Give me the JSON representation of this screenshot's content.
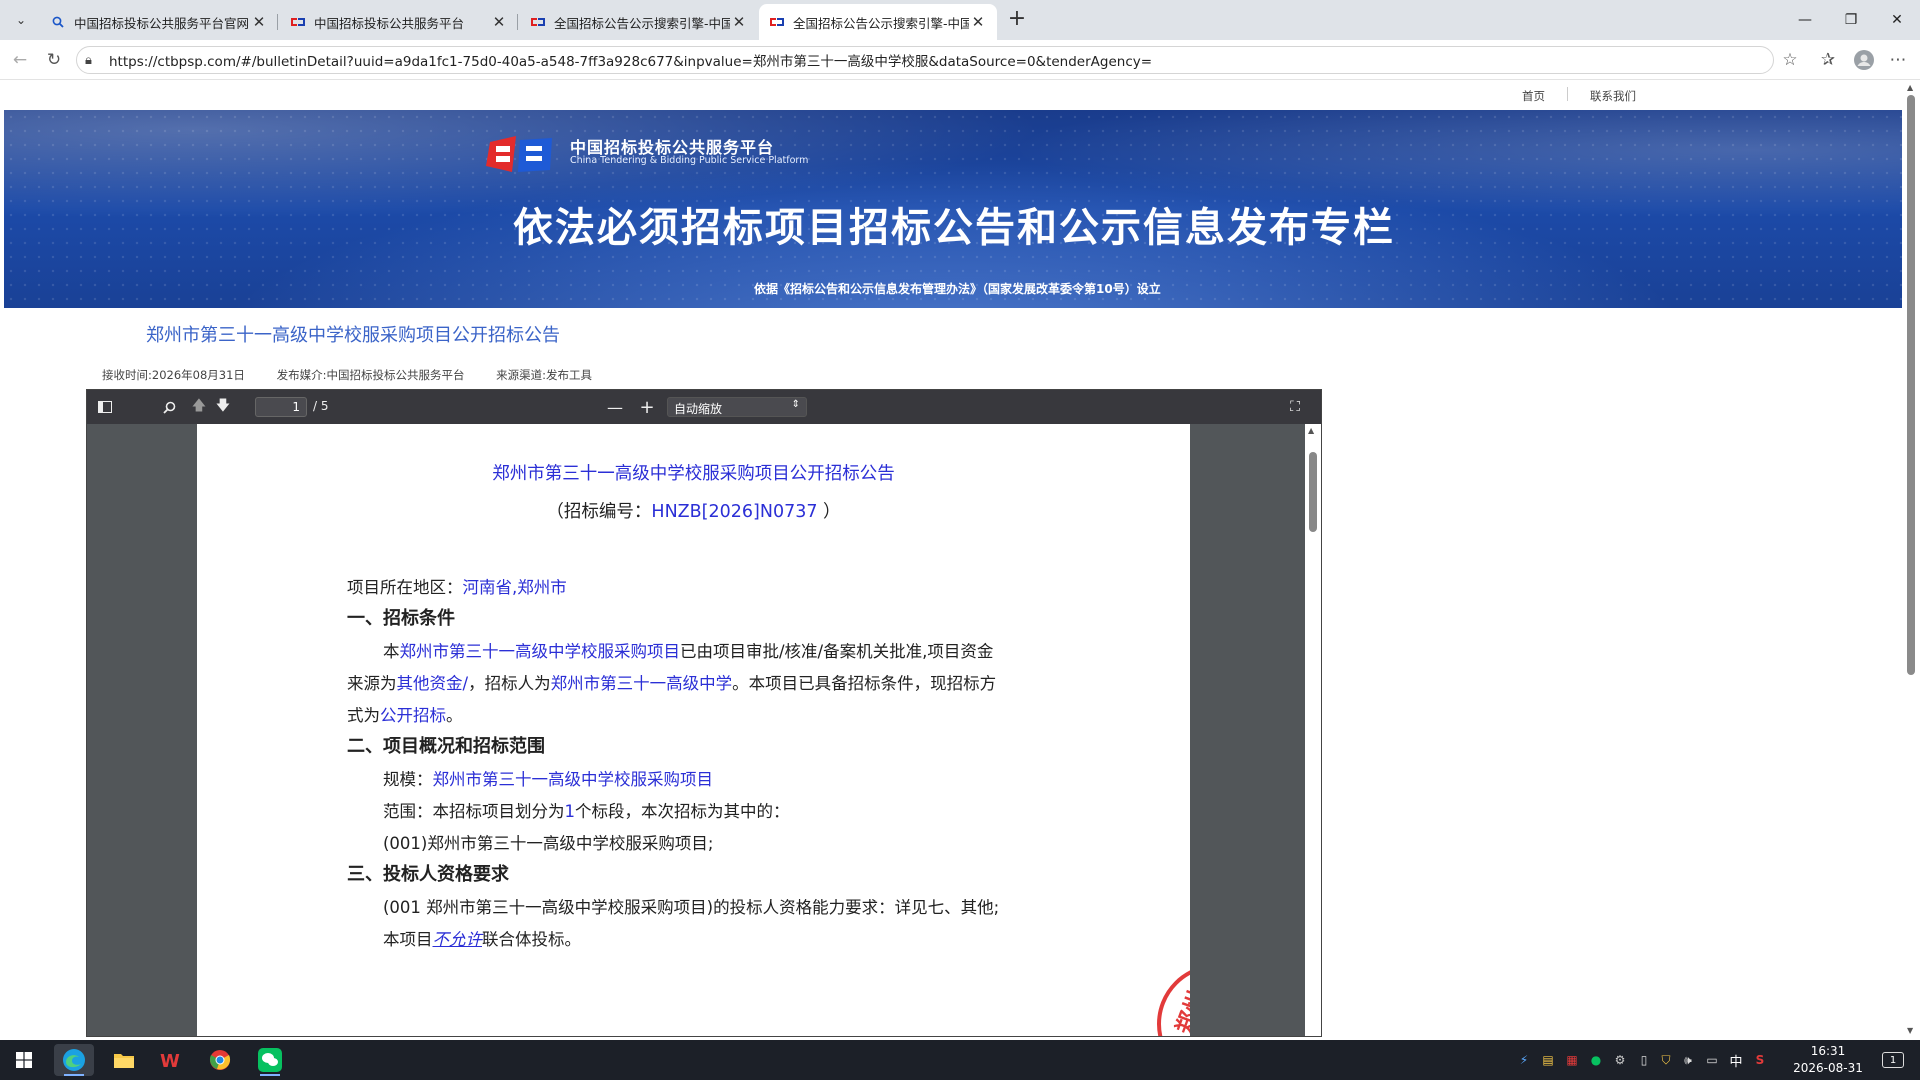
{
  "browser": {
    "tabs": [
      {
        "title": "中国招标投标公共服务平台官网 - 前",
        "icon": "search-icon",
        "active": false
      },
      {
        "title": "中国招标投标公共服务平台",
        "icon": "site-logo-icon",
        "active": false
      },
      {
        "title": "全国招标公告公示搜索引擎-中国招",
        "icon": "site-logo-icon",
        "active": false
      },
      {
        "title": "全国招标公告公示搜索引擎-中国招",
        "icon": "site-logo-icon",
        "active": true
      }
    ],
    "url": "https://ctbpsp.com/#/bulletinDetail?uuid=a9da1fc1-75d0-40a5-a548-7ff3a928c677&inpvalue=郑州市第三十一高级中学校服&dataSource=0&tenderAgency="
  },
  "site": {
    "topnav": {
      "home": "首页",
      "contact": "联系我们"
    },
    "logo_cn": "中国招标投标公共服务平台",
    "logo_en": "China Tendering & Bidding Public Service Platform",
    "banner_title": "依法必须招标项目招标公告和公示信息发布专栏",
    "banner_basis": "依据《招标公告和公示信息发布管理办法》（国家发展改革委令第10号）设立"
  },
  "bulletin": {
    "title": "郑州市第三十一高级中学校服采购项目公开招标公告",
    "received": "接收时间:2026年08月31日",
    "media": "发布媒介:中国招标投标公共服务平台",
    "source": "来源渠道:发布工具"
  },
  "pdf": {
    "page": "1",
    "total": "/ 5",
    "zoom": "自动缩放",
    "title": "郑州市第三十一高级中学校服采购项目公开招标公告",
    "code_prefix": "（招标编号：",
    "code": "HNZB[2026]N0737",
    "code_suffix": " ）",
    "region_label": "项目所在地区：",
    "region": "河南省,郑州市",
    "sec1": "一、招标条件",
    "p1_a": "本",
    "p1_b": "郑州市第三十一高级中学校服采购项目",
    "p1_c": "已由项目审批/核准/备案机关批准,项目资金",
    "p2_a": "来源为",
    "p2_b": "其他资金/",
    "p2_c": "，招标人为",
    "p2_d": "郑州市第三十一高级中学",
    "p2_e": "。本项目已具备招标条件，现招标方",
    "p3_a": "式为",
    "p3_b": "公开招标",
    "p3_c": "。",
    "sec2": "二、项目概况和招标范围",
    "scale_label": "规模：",
    "scale": "郑州市第三十一高级中学校服采购项目",
    "scope_a": "范围：本招标项目划分为",
    "scope_b": "1",
    "scope_c": "个标段，本次招标为其中的：",
    "lot": "(001)郑州市第三十一高级中学校服采购项目;",
    "sec3": "三、投标人资格要求",
    "req": "(001 郑州市第三十一高级中学校服采购项目)的投标人资格能力要求：详见七、其他;",
    "joint_a": "本项目",
    "joint_b": "不允许",
    "joint_c": "联合体投标。",
    "stamp": "郑州"
  },
  "taskbar": {
    "apps": [
      "start-icon",
      "edge-icon",
      "file-explorer-icon",
      "wps-icon",
      "chrome-icon",
      "wechat-icon"
    ],
    "ime": "中",
    "time": "16:31",
    "date": "2026-08-31",
    "notifications": "1"
  },
  "colors": {
    "link": "#3b64c8",
    "doc_blue": "#2b2fd6",
    "banner": "#1c4aa8",
    "stamp": "#e23a3a"
  }
}
